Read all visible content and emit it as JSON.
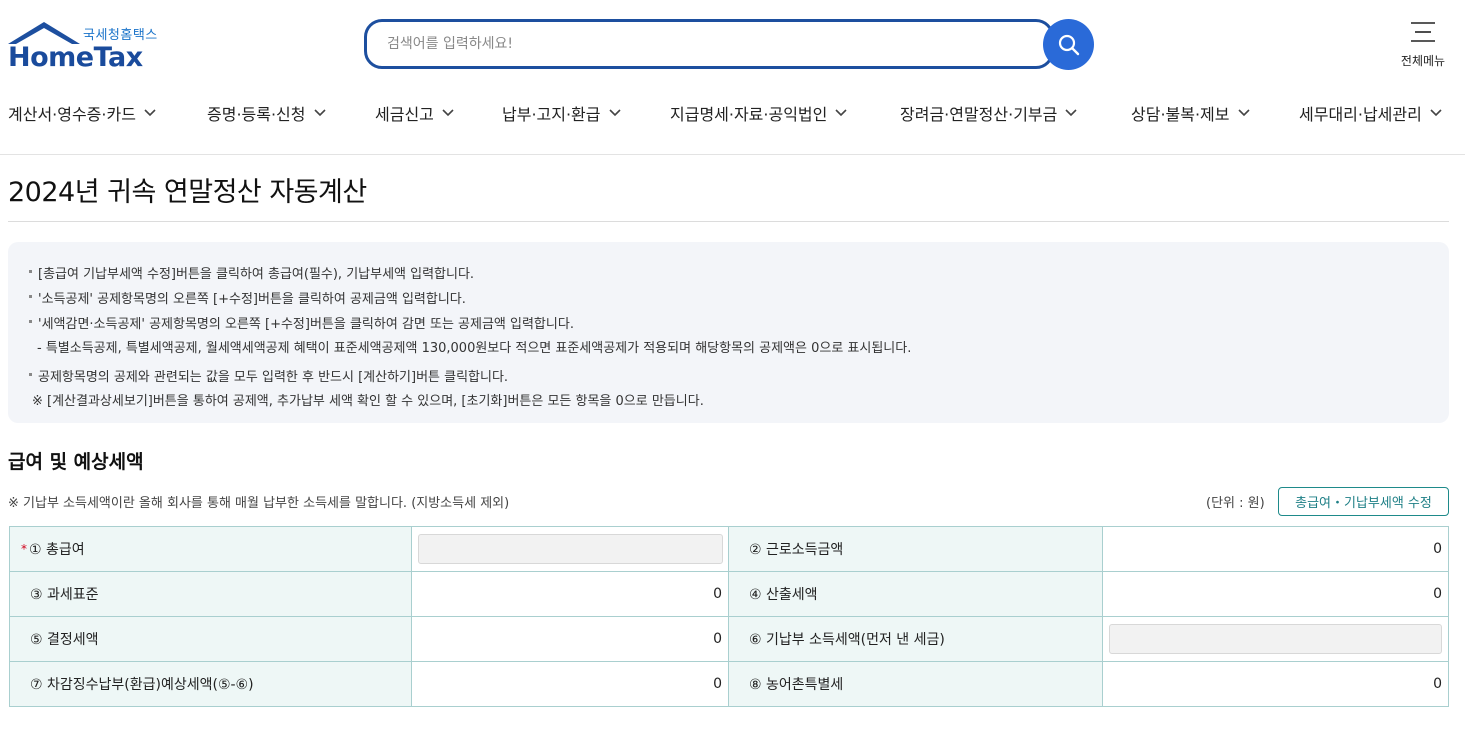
{
  "header": {
    "logo_sub": "국세청홈택스",
    "logo_main": "HomeTax",
    "search_placeholder": "검색어를 입력하세요!",
    "menu_label": "전체메뉴"
  },
  "gnb": [
    "계산서·영수증·카드",
    "증명·등록·신청",
    "세금신고",
    "납부·고지·환급",
    "지급명세·자료·공익법인",
    "장려금·연말정산·기부금",
    "상담·불복·제보",
    "세무대리·납세관리"
  ],
  "page_title": "2024년 귀속 연말정산 자동계산",
  "info": {
    "line1": "[총급여 기납부세액 수정]버튼을 클릭하여 총급여(필수), 기납부세액 입력합니다.",
    "line2": "'소득공제' 공제항목명의 오른쪽 [+수정]버튼을 클릭하여 공제금액 입력합니다.",
    "line3": "'세액감면·소득공제' 공제항목명의 오른쪽 [+수정]버튼을 클릭하여 감면 또는 공제금액 입력합니다.",
    "line4": "- 특별소득공제, 특별세액공제, 월세액세액공제 혜택이 표준세액공제액 130,000원보다 적으면 표준세액공제가 적용되며 해당항목의 공제액은 0으로 표시됩니다.",
    "line5": "공제항목명의 공제와 관련되는 값을 모두 입력한 후 반드시 [계산하기]버튼 클릭합니다.",
    "line6": "※ [계산결과상세보기]버튼을 통하여 공제액, 추가납부 세액 확인 할 수 있으며, [초기화]버튼은 모든 항목을 0으로 만듭니다."
  },
  "section": {
    "title": "급여 및 예상세액",
    "note": "※ 기납부 소득세액이란 올해 회사를 통해 매월 납부한 소득세를 말합니다. (지방소득세 제외)",
    "unit": "(단위 : 원)",
    "edit_button": "총급여・기납부세액 수정",
    "required_mark": "*"
  },
  "table": {
    "r1": {
      "label_a": "① 총급여",
      "value_a": "",
      "label_b": "② 근로소득금액",
      "value_b": "0"
    },
    "r2": {
      "label_a": "③ 과세표준",
      "value_a": "0",
      "label_b": "④ 산출세액",
      "value_b": "0"
    },
    "r3": {
      "label_a": "⑤ 결정세액",
      "value_a": "0",
      "label_b": "⑥ 기납부 소득세액(먼저 낸 세금)",
      "value_b": ""
    },
    "r4": {
      "label_a": "⑦ 차감징수납부(환급)예상세액(⑤-⑥)",
      "value_a": "0",
      "label_b": "⑧ 농어촌특별세",
      "value_b": "0"
    }
  },
  "colors": {
    "brand_blue": "#1d4f9f",
    "search_button": "#2a6ad8",
    "table_border": "#a9cfcf",
    "table_header_bg": "#eef7f6",
    "edit_button_teal": "#1e7f86"
  }
}
